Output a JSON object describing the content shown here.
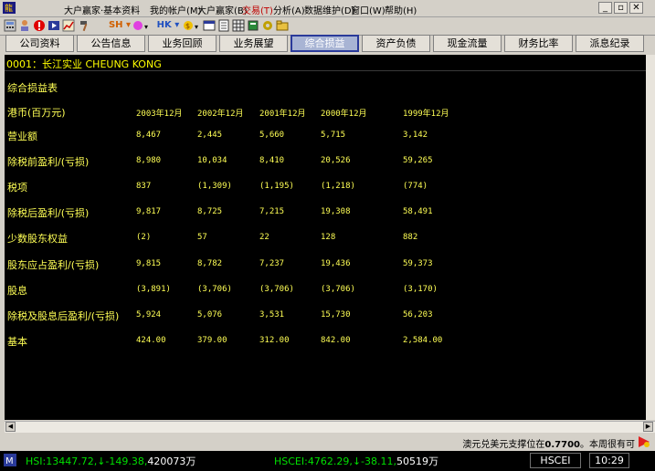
{
  "menubar": {
    "title": "大户赢家·基本资料",
    "items": [
      {
        "label": "我的帐户(M)",
        "highlight": false
      },
      {
        "label": "大户赢家(B)",
        "highlight": false
      },
      {
        "label": "交易(T)",
        "highlight": true
      },
      {
        "label": "分析(A)",
        "highlight": false
      },
      {
        "label": "数据维护(D)",
        "highlight": false
      },
      {
        "label": "窗口(W)",
        "highlight": false
      },
      {
        "label": "帮助(H)",
        "highlight": false
      }
    ]
  },
  "toolbar": {
    "sh_label": "SH",
    "hk_label": "HK"
  },
  "tabs": [
    {
      "label": "公司资料",
      "active": false
    },
    {
      "label": "公告信息",
      "active": false
    },
    {
      "label": "业务回顾",
      "active": false
    },
    {
      "label": "业务展望",
      "active": false
    },
    {
      "label": "综合损益",
      "active": true
    },
    {
      "label": "资产负债",
      "active": false
    },
    {
      "label": "现金流量",
      "active": false
    },
    {
      "label": "财务比率",
      "active": false
    },
    {
      "label": "派息纪录",
      "active": false
    }
  ],
  "stock": {
    "label": "0001：长江实业  CHEUNG KONG"
  },
  "report": {
    "title": "综合损益表",
    "unit_label": "港币(百万元)",
    "years": [
      "2003年12月",
      "2002年12月",
      "2001年12月",
      "2000年12月",
      "1999年12月"
    ],
    "rows": [
      {
        "label": "营业额",
        "values": [
          "8,467",
          "2,445",
          "5,660",
          "5,715",
          "3,142"
        ]
      },
      {
        "label": "除税前盈利/(亏损)",
        "values": [
          "8,980",
          "10,034",
          "8,410",
          "20,526",
          "59,265"
        ]
      },
      {
        "label": "税项",
        "values": [
          "837",
          "(1,309)",
          "(1,195)",
          "(1,218)",
          "(774)"
        ]
      },
      {
        "label": "除税后盈利/(亏损)",
        "values": [
          "9,817",
          "8,725",
          "7,215",
          "19,308",
          "58,491"
        ]
      },
      {
        "label": "少数股东权益",
        "values": [
          "(2)",
          "57",
          "22",
          "128",
          "882"
        ]
      },
      {
        "label": "股东应占盈利/(亏损)",
        "values": [
          "9,815",
          "8,782",
          "7,237",
          "19,436",
          "59,373"
        ]
      },
      {
        "label": "股息",
        "values": [
          "(3,891)",
          "(3,706)",
          "(3,706)",
          "(3,706)",
          "(3,170)"
        ]
      },
      {
        "label": "除税及股息后盈利/(亏损)",
        "values": [
          "5,924",
          "5,076",
          "3,531",
          "15,730",
          "56,203"
        ]
      },
      {
        "label": "基本",
        "values": [
          "424.00",
          "379.00",
          "312.00",
          "842.00",
          "2,584.00"
        ]
      }
    ]
  },
  "ticker": {
    "text_before": "澳元兑美元支撑位在",
    "value": "0.7700",
    "text_after": "。本周很有可"
  },
  "status": {
    "hsi_label": "HSI:13447.72,",
    "hsi_change": "↓-149.38,",
    "hsi_volume": "420073万",
    "hscei_label": "HSCEI:4762.29,",
    "hscei_change": "↓-38.11,",
    "hscei_volume": "50519万",
    "index_name": "HSCEI",
    "time": "10:29"
  },
  "colors": {
    "report_text": "#ffff55",
    "active_tab": "#a8b4d4",
    "status_green": "#00e000",
    "status_white": "#ffffff",
    "menu_highlight": "#c00000"
  }
}
